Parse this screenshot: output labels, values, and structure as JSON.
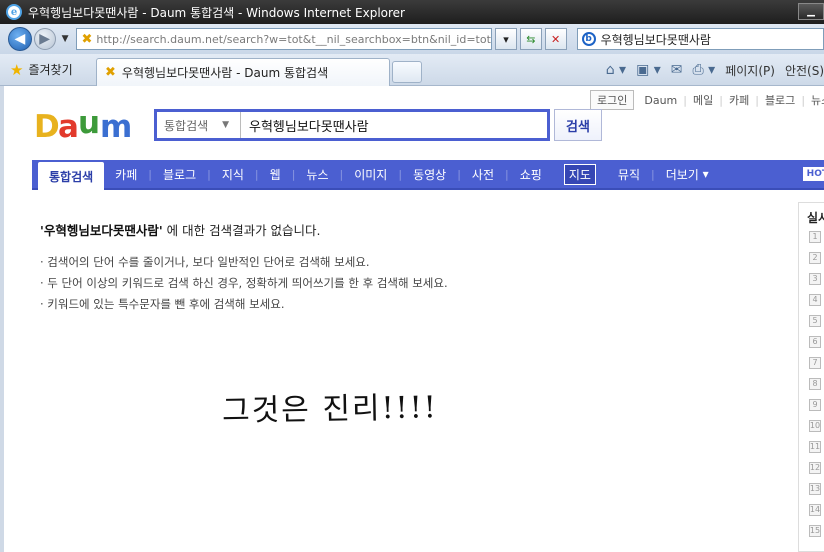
{
  "window": {
    "title": "우혁헹님보다못땐사람 - Daum 통합검색 - Windows Internet Explorer",
    "address": "http://search.daum.net/search?w=tot&t__nil_searchbox=btn&nil_id=tot&stype",
    "address_domain": "daum.net",
    "search_box_value": "우혁헹님보다못땐사람"
  },
  "tabs": {
    "favorites_label": "즐겨찾기",
    "active_tab_label": "우혁헹님보다못땐사람 - Daum 통합검색",
    "page_menu": "페이지(P)",
    "safety_menu": "안전(S)"
  },
  "toplinks": {
    "login": "로그인",
    "items": [
      "Daum",
      "메일",
      "카페",
      "블로그",
      "뉴스"
    ]
  },
  "search": {
    "category": "통합검색",
    "query": "우혁헹님보다못땐사람",
    "button": "검색"
  },
  "nav": {
    "items": [
      "통합검색",
      "카페",
      "블로그",
      "지식",
      "웹",
      "뉴스",
      "이미지",
      "동영상",
      "사전",
      "쇼핑",
      "지도",
      "뮤직",
      "더보기"
    ],
    "hot_label": "HOT"
  },
  "results": {
    "query_quoted": "'우혁헹님보다못땐사람'",
    "no_result_suffix": " 에 대한 검색결과가 없습니다.",
    "tips": [
      "· 검색어의 단어 수를 줄이거나, 보다 일반적인 단어로 검색해 보세요.",
      "· 두 단어 이상의 키워드로 검색 하신 경우, 정확하게 띄어쓰기를 한 후 검색해 보세요.",
      "· 키워드에 있는 특수문자를 뺀 후에 검색해 보세요."
    ]
  },
  "handwriting": "그것은 진리!!!!",
  "sidebar": {
    "title": "실시",
    "ranks": [
      "1",
      "2",
      "3",
      "4",
      "5",
      "6",
      "7",
      "8",
      "9",
      "10",
      "11",
      "12",
      "13",
      "14",
      "15"
    ]
  },
  "colors": {
    "daum_blue": "#4b5fd1"
  }
}
